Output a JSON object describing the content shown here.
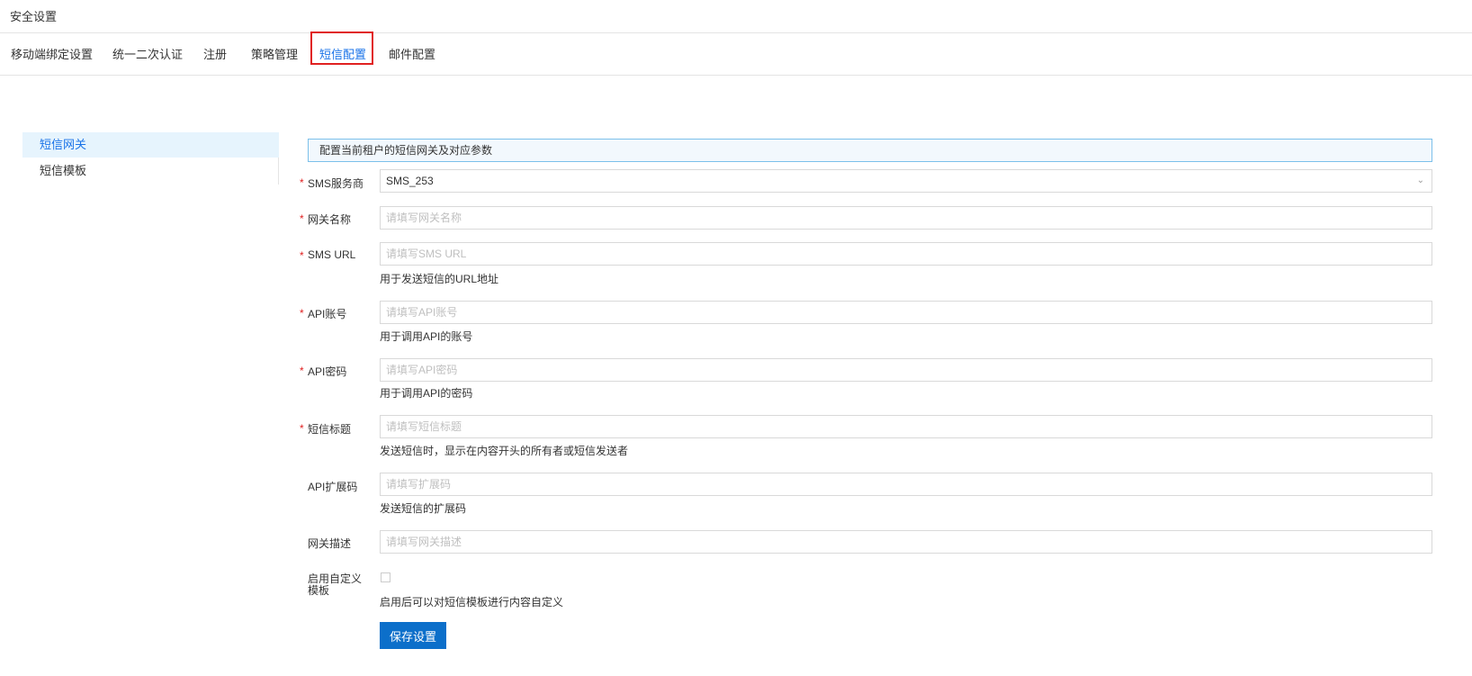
{
  "header": {
    "title": "安全设置"
  },
  "tabs": [
    {
      "label": "移动端绑定设置"
    },
    {
      "label": "统一二次认证"
    },
    {
      "label": "注册"
    },
    {
      "label": "策略管理"
    },
    {
      "label": "短信配置"
    },
    {
      "label": "邮件配置"
    }
  ],
  "active_tab": "短信配置",
  "left_nav": [
    {
      "label": "短信网关"
    },
    {
      "label": "短信模板"
    }
  ],
  "info": "配置当前租户的短信网关及对应参数",
  "form": {
    "provider": {
      "label": "SMS服务商",
      "value": "SMS_253"
    },
    "gateway_name": {
      "label": "网关名称",
      "placeholder": "请填写网关名称"
    },
    "sms_url": {
      "label": "SMS URL",
      "placeholder": "请填写SMS URL",
      "help": "用于发送短信的URL地址"
    },
    "api_account": {
      "label": "API账号",
      "placeholder": "请填写API账号",
      "help": "用于调用API的账号"
    },
    "api_password": {
      "label": "API密码",
      "placeholder": "请填写API密码",
      "help": "用于调用API的密码"
    },
    "sms_title": {
      "label": "短信标题",
      "placeholder": "请填写短信标题",
      "help": "发送短信时，显示在内容开头的所有者或短信发送者"
    },
    "api_ext": {
      "label": "API扩展码",
      "placeholder": "请填写扩展码",
      "help": "发送短信的扩展码"
    },
    "gateway_desc": {
      "label": "网关描述",
      "placeholder": "请填写网关描述"
    },
    "custom_template": {
      "label": "启用自定义模板",
      "checked": false,
      "help": "启用后可以对短信模板进行内容自定义"
    },
    "required_mark": "*"
  },
  "save_label": "保存设置",
  "colors": {
    "accent": "#0c6fca",
    "active_text": "#1a73e8",
    "required": "#e02020",
    "highlight_box": "#e02020"
  }
}
